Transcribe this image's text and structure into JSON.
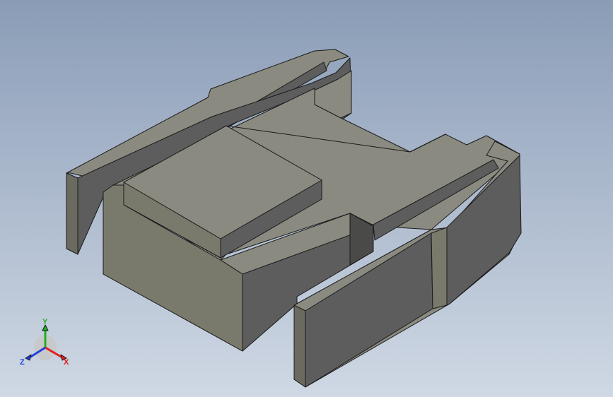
{
  "viewport": {
    "background_top": "#8a9cb6",
    "background_bottom": "#cfd8e4"
  },
  "model": {
    "face_colors": {
      "top": "#8a8a80",
      "front": "#7a7a6c",
      "side": "#5d5d5d",
      "dark": "#4a4a48",
      "edge": "#1a1a1a"
    }
  },
  "triad": {
    "x_label": "X",
    "y_label": "Y",
    "z_label": "Z",
    "x_color": "#e02020",
    "y_color": "#20b020",
    "z_color": "#2040e0"
  }
}
